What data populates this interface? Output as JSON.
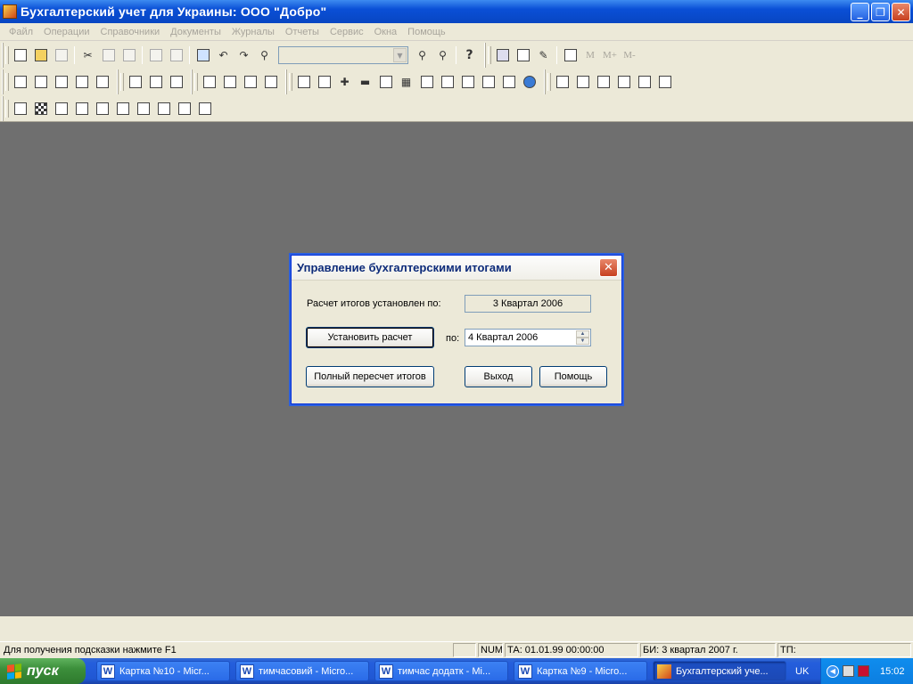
{
  "window": {
    "title": "Бухгалтерский учет для Украины: ООО \"Добро\""
  },
  "menu": [
    "Файл",
    "Операции",
    "Справочники",
    "Документы",
    "Журналы",
    "Отчеты",
    "Сервис",
    "Окна",
    "Помощь"
  ],
  "toolbar": {
    "m_label": "M",
    "mplus_label": "M+",
    "mminus_label": "M-",
    "help_glyph": "?"
  },
  "dialog": {
    "title": "Управление  бухгалтерскими итогами",
    "calc_label": "Расчет итогов установлен по:",
    "calc_value": "3 Квартал 2006",
    "set_button": "Установить расчет",
    "to_label": "по:",
    "to_value": "4 Квартал 2006",
    "recalc_button": "Полный пересчет итогов",
    "exit_button": "Выход",
    "help_button": "Помощь",
    "close_glyph": "✕"
  },
  "status": {
    "hint": "Для получения подсказки нажмите F1",
    "num": "NUM",
    "ta": "ТА: 01.01.99  00:00:00",
    "bi": "БИ: 3 квартал 2007 г.",
    "tp": "ТП:"
  },
  "taskbar": {
    "start": "пуск",
    "tasks": [
      "Картка №10 - Micr...",
      "тимчасовий - Micro...",
      "тимчас додатк - Mi...",
      "Картка №9 - Micro...",
      "Бухгалтерский уче..."
    ],
    "lang": "UK",
    "clock": "15:02"
  }
}
